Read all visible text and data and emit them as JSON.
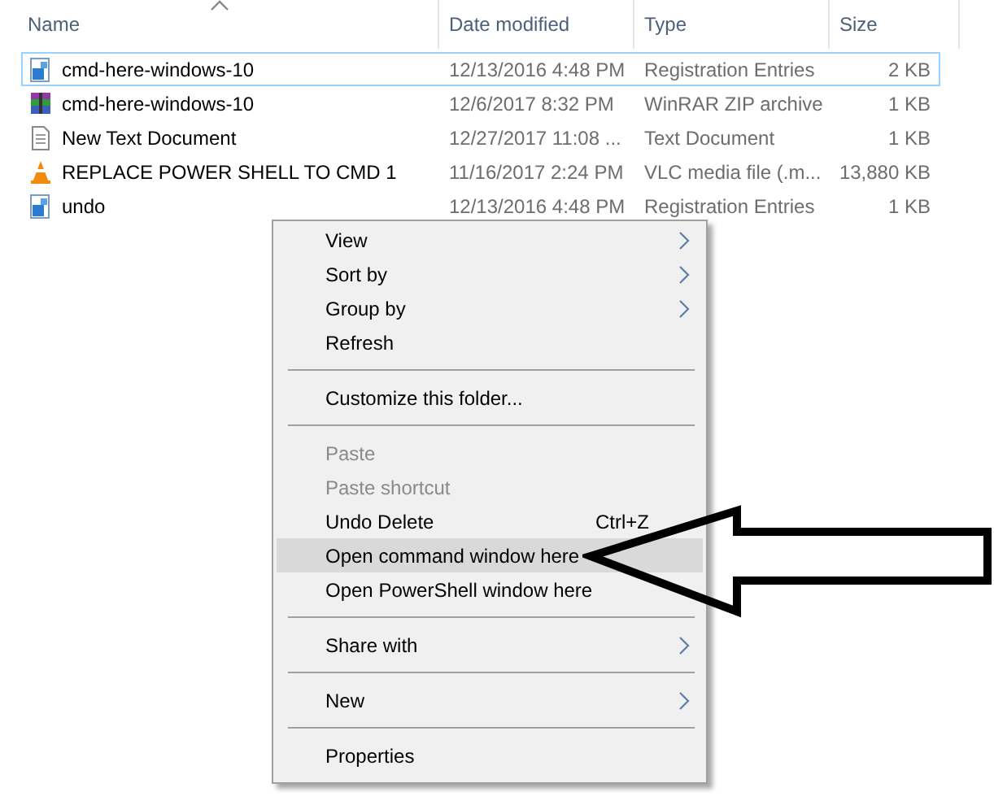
{
  "columns": [
    {
      "label": "Name",
      "sorted": true
    },
    {
      "label": "Date modified",
      "sorted": false
    },
    {
      "label": "Type",
      "sorted": false
    },
    {
      "label": "Size",
      "sorted": false
    }
  ],
  "files": [
    {
      "name": "cmd-here-windows-10",
      "kind": "registry",
      "date": "12/13/2016 4:48 PM",
      "type": "Registration Entries",
      "size": "2 KB",
      "selected": true
    },
    {
      "name": "cmd-here-windows-10",
      "kind": "archive",
      "date": "12/6/2017 8:32 PM",
      "type": "WinRAR ZIP archive",
      "size": "1 KB",
      "selected": false
    },
    {
      "name": "New Text Document",
      "kind": "text",
      "date": "12/27/2017 11:08 ...",
      "type": "Text Document",
      "size": "1 KB",
      "selected": false
    },
    {
      "name": "REPLACE POWER SHELL TO CMD 1",
      "kind": "media",
      "date": "11/16/2017 2:24 PM",
      "type": "VLC media file (.m...",
      "size": "13,880 KB",
      "selected": false
    },
    {
      "name": "undo",
      "kind": "registry",
      "date": "12/13/2016 4:48 PM",
      "type": "Registration Entries",
      "size": "1 KB",
      "selected": false
    }
  ],
  "context_menu": [
    {
      "kind": "item",
      "label": "View",
      "submenu": true,
      "disabled": false,
      "selected": false
    },
    {
      "kind": "item",
      "label": "Sort by",
      "submenu": true,
      "disabled": false,
      "selected": false
    },
    {
      "kind": "item",
      "label": "Group by",
      "submenu": true,
      "disabled": false,
      "selected": false
    },
    {
      "kind": "item",
      "label": "Refresh",
      "submenu": false,
      "disabled": false,
      "selected": false
    },
    {
      "kind": "separator"
    },
    {
      "kind": "item",
      "label": "Customize this folder...",
      "submenu": false,
      "disabled": false,
      "selected": false
    },
    {
      "kind": "separator"
    },
    {
      "kind": "item",
      "label": "Paste",
      "submenu": false,
      "disabled": true,
      "selected": false
    },
    {
      "kind": "item",
      "label": "Paste shortcut",
      "submenu": false,
      "disabled": true,
      "selected": false
    },
    {
      "kind": "item",
      "label": "Undo Delete",
      "shortcut": "Ctrl+Z",
      "submenu": false,
      "disabled": false,
      "selected": false
    },
    {
      "kind": "item",
      "label": "Open command window here",
      "submenu": false,
      "disabled": false,
      "selected": true
    },
    {
      "kind": "item",
      "label": "Open PowerShell window here",
      "submenu": false,
      "disabled": false,
      "selected": false
    },
    {
      "kind": "separator"
    },
    {
      "kind": "item",
      "label": "Share with",
      "submenu": true,
      "disabled": false,
      "selected": false
    },
    {
      "kind": "separator"
    },
    {
      "kind": "item",
      "label": "New",
      "submenu": true,
      "disabled": false,
      "selected": false
    },
    {
      "kind": "separator"
    },
    {
      "kind": "item",
      "label": "Properties",
      "submenu": false,
      "disabled": false,
      "selected": false
    }
  ]
}
